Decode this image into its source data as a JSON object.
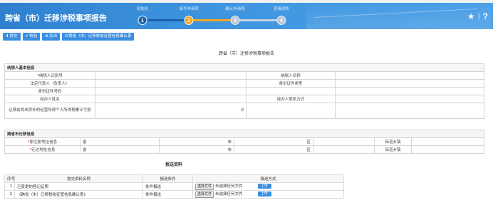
{
  "header": {
    "app_title": "跨省（市）迁移涉税事项报告",
    "steps": [
      {
        "num": "1",
        "label": "初始化",
        "state": "done"
      },
      {
        "num": "2",
        "label": "填写申请表",
        "state": "current"
      },
      {
        "num": "3",
        "label": "确认申请表",
        "state": "todo"
      },
      {
        "num": "4",
        "label": "查看回执",
        "state": "todo"
      }
    ],
    "star_icon": "star-icon",
    "separator": "|",
    "help_label": "?"
  },
  "toolbar": {
    "submit": "提交",
    "verify": "校验",
    "close": "关闭",
    "confirm": "跨省（市）迁移税收征管信息确认表"
  },
  "form_title": "跨省（市）迁移涉税事项报告",
  "basic": {
    "section": "纳税人基本信息",
    "tax_id_label": "纳税人识别号",
    "tax_id_value": "",
    "taxpayer_name_label": "纳税人名称",
    "taxpayer_name_value": "",
    "legal_rep_label": "法定代表人（负责人）",
    "legal_rep_value": "",
    "id_type_label": "身份证件类型",
    "id_type_value": "",
    "id_no_label": "身份证件号码",
    "id_no_value": "",
    "handler_name_label": "经办人姓名",
    "handler_name_value": "",
    "handler_phone_label": "经办人联系方式",
    "handler_phone_value": "",
    "pending_label": "迁移前尚未弥补的经营所得个人所得税累计亏损",
    "pending_value": "0"
  },
  "address": {
    "section": "跨省市迁移信息",
    "origin_label": "原注册地址信息",
    "dest_label": "迁达地址信息",
    "province": "省",
    "city": "市",
    "district": "区",
    "street": "街道乡镇"
  },
  "attachments": {
    "title": "报送资料",
    "col_no": "序号",
    "col_name": "提交资料名称",
    "col_cond": "报送条件",
    "col_mode": "报送方式",
    "choose_label": "选择文件",
    "no_file_label": "未选择任何文件",
    "upload_label": "上传",
    "rows": [
      {
        "no": "1",
        "name": "已变更的登记证照",
        "cond": "条件报送"
      },
      {
        "no": "2",
        "name": "《跨省（市）迁移税收征管信息确认表》",
        "cond": "条件报送"
      }
    ]
  },
  "colors": {
    "header_blue": "#3f95df",
    "button_blue": "#3a8ee0",
    "current_step": "#f5a623",
    "required": "#e60012"
  }
}
